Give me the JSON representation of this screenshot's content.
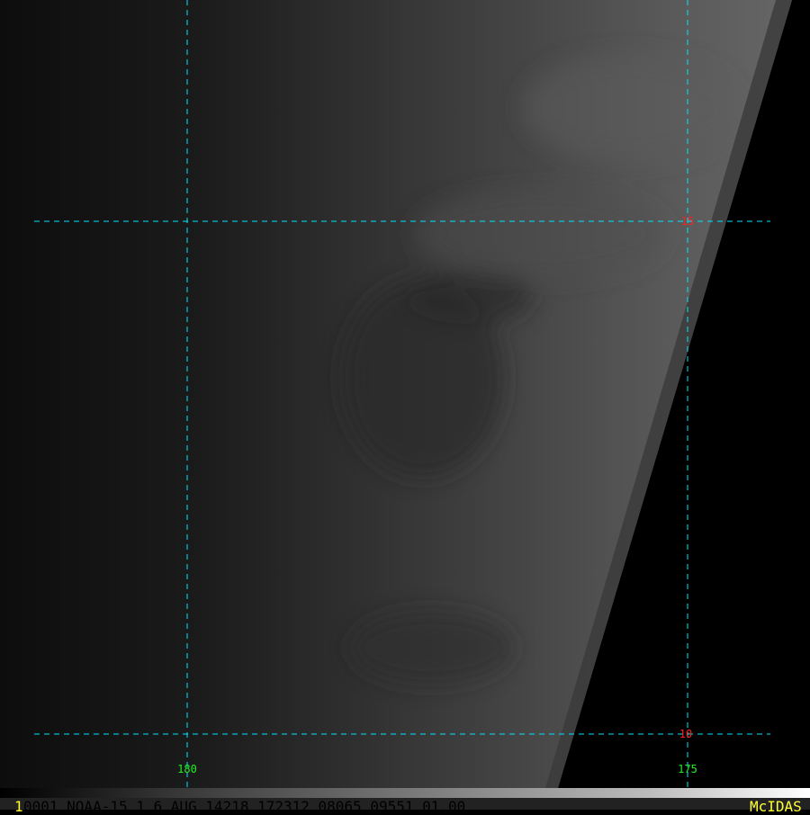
{
  "grid": {
    "latitudes": [
      "15",
      "10"
    ],
    "longitudes": [
      "180",
      "175"
    ],
    "line_color": "#00e5ff",
    "lat_label_color": "#ff2020",
    "lon_label_color": "#22ee22"
  },
  "footer": {
    "frame_number": "1",
    "metadata": "0001 NOAA-15     1   6 AUG 14218 172312 08065 09551 01.00",
    "brand": "McIDAS"
  }
}
